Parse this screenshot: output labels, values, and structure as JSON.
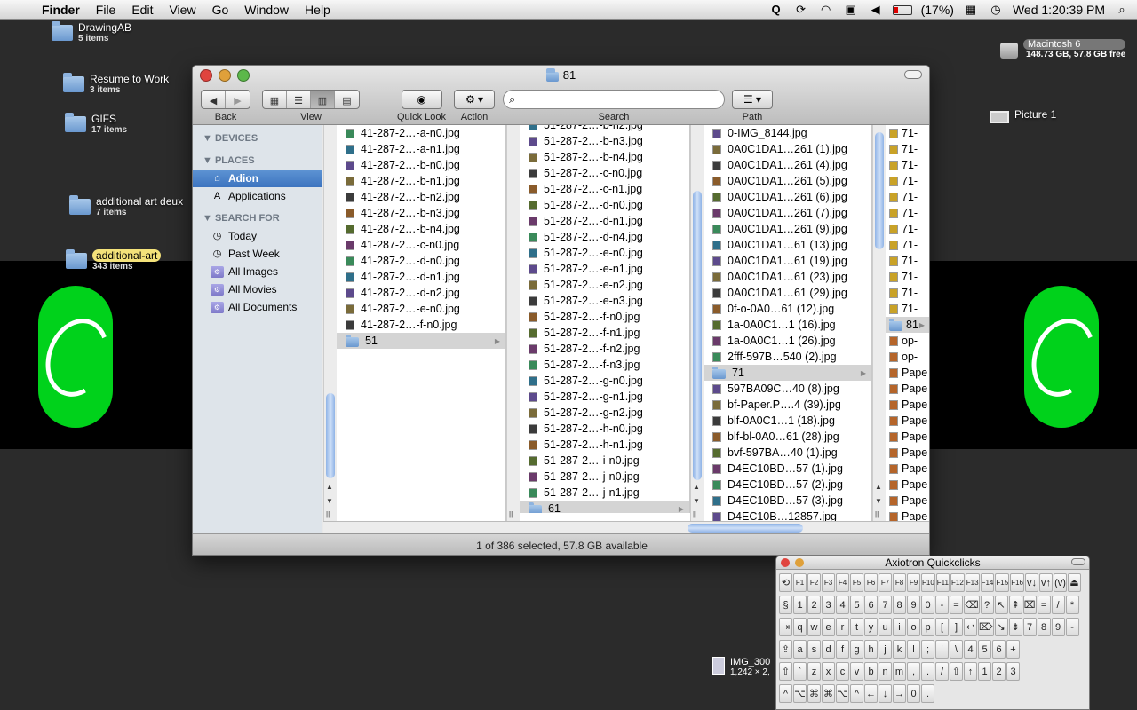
{
  "menubar": {
    "app": "Finder",
    "items": [
      "File",
      "Edit",
      "View",
      "Go",
      "Window",
      "Help"
    ],
    "battery": "(17%)",
    "clock": "Wed 1:20:39 PM"
  },
  "desktop": {
    "icons": [
      {
        "name": "DrawingAB",
        "sub": "5 items"
      },
      {
        "name": "Resume to Work",
        "sub": "3 items"
      },
      {
        "name": "GIFS",
        "sub": "17 items"
      },
      {
        "name": "additional art deux",
        "sub": "7 items"
      },
      {
        "name": "additional-art",
        "sub": "343 items"
      }
    ],
    "drive": {
      "name": "Macintosh 6",
      "sub": "148.73 GB, 57.8 GB free"
    },
    "picture": {
      "name": "Picture 1"
    },
    "img_file": {
      "name": "IMG_300",
      "sub": "1,242 × 2,"
    }
  },
  "finder": {
    "title": "81",
    "toolbar": {
      "back_label": "Back",
      "view_label": "View",
      "quicklook_label": "Quick Look",
      "action_label": "Action",
      "search_label": "Search",
      "search_placeholder": "",
      "path_label": "Path"
    },
    "sidebar": {
      "devices": "DEVICES",
      "places": "PLACES",
      "places_items": [
        "Adion",
        "Applications"
      ],
      "search_for": "SEARCH FOR",
      "search_items": [
        "Today",
        "Past Week",
        "All Images",
        "All Movies",
        "All Documents"
      ]
    },
    "columns": [
      {
        "items": [
          "41-287-2…-a-n0.jpg",
          "41-287-2…-a-n1.jpg",
          "41-287-2…-b-n0.jpg",
          "41-287-2…-b-n1.jpg",
          "41-287-2…-b-n2.jpg",
          "41-287-2…-b-n3.jpg",
          "41-287-2…-b-n4.jpg",
          "41-287-2…-c-n0.jpg",
          "41-287-2…-d-n0.jpg",
          "41-287-2…-d-n1.jpg",
          "41-287-2…-d-n2.jpg",
          "41-287-2…-e-n0.jpg",
          "41-287-2…-f-n0.jpg"
        ],
        "folder": "51"
      },
      {
        "items": [
          "51-287-2…-b-n2.jpg",
          "51-287-2…-b-n3.jpg",
          "51-287-2…-b-n4.jpg",
          "51-287-2…-c-n0.jpg",
          "51-287-2…-c-n1.jpg",
          "51-287-2…-d-n0.jpg",
          "51-287-2…-d-n1.jpg",
          "51-287-2…-d-n4.jpg",
          "51-287-2…-e-n0.jpg",
          "51-287-2…-e-n1.jpg",
          "51-287-2…-e-n2.jpg",
          "51-287-2…-e-n3.jpg",
          "51-287-2…-f-n0.jpg",
          "51-287-2…-f-n1.jpg",
          "51-287-2…-f-n2.jpg",
          "51-287-2…-f-n3.jpg",
          "51-287-2…-g-n0.jpg",
          "51-287-2…-g-n1.jpg",
          "51-287-2…-g-n2.jpg",
          "51-287-2…-h-n0.jpg",
          "51-287-2…-h-n1.jpg",
          "51-287-2…-i-n0.jpg",
          "51-287-2…-j-n0.jpg",
          "51-287-2…-j-n1.jpg"
        ],
        "folder": "61"
      },
      {
        "items_top": [
          "0-IMG_8144.jpg",
          "0A0C1DA1…261 (1).jpg",
          "0A0C1DA1…261 (4).jpg",
          "0A0C1DA1…261 (5).jpg",
          "0A0C1DA1…261 (6).jpg",
          "0A0C1DA1…261 (7).jpg",
          "0A0C1DA1…261 (9).jpg",
          "0A0C1DA1…61 (13).jpg",
          "0A0C1DA1…61 (19).jpg",
          "0A0C1DA1…61 (23).jpg",
          "0A0C1DA1…61 (29).jpg",
          "0f-o-0A0…61 (12).jpg",
          "1a-0A0C1…1 (16).jpg",
          "1a-0A0C1…1 (26).jpg",
          "2fff-597B…540 (2).jpg"
        ],
        "folder": "71",
        "items_bottom": [
          "597BA09C…40 (8).jpg",
          "bf-Paper.P….4 (39).jpg",
          "blf-0A0C1…1 (18).jpg",
          "blf-bl-0A0…61 (28).jpg",
          "bvf-597BA…40 (1).jpg",
          "D4EC10BD…57 (1).jpg",
          "D4EC10BD…57 (2).jpg",
          "D4EC10BD…57 (3).jpg",
          "D4EC10B…12857.jpg"
        ]
      },
      {
        "items_top": [
          "71-",
          "71-",
          "71-",
          "71-",
          "71-",
          "71-",
          "71-",
          "71-",
          "71-",
          "71-",
          "71-",
          "71-"
        ],
        "folder": "81",
        "items_bottom": [
          "op-",
          "op-",
          "Pape",
          "Pape",
          "Pape",
          "Pape",
          "Pape",
          "Pape",
          "Pape",
          "Pape",
          "Pape",
          "Pape"
        ]
      }
    ],
    "status": "1 of 386 selected, 57.8 GB available"
  },
  "quickclicks": {
    "title": "Axiotron Quickclicks",
    "rows": [
      [
        "⟲",
        "F1",
        "F2",
        "F3",
        "F4",
        "F5",
        "F6",
        "F7",
        "F8",
        "F9",
        "F10",
        "F11",
        "F12",
        "F13",
        "F14",
        "F15",
        "F16",
        "v↓",
        "v↑",
        "(v)",
        "⏏"
      ],
      [
        "§",
        "1",
        "2",
        "3",
        "4",
        "5",
        "6",
        "7",
        "8",
        "9",
        "0",
        "-",
        "=",
        "⌫",
        "?",
        "↖",
        "⇞",
        "⌧",
        "=",
        "/",
        "*"
      ],
      [
        "⇥",
        "q",
        "w",
        "e",
        "r",
        "t",
        "y",
        "u",
        "i",
        "o",
        "p",
        "[",
        "]",
        "↩",
        "⌦",
        "↘",
        "⇟",
        "7",
        "8",
        "9",
        "-"
      ],
      [
        "⇪",
        "a",
        "s",
        "d",
        "f",
        "g",
        "h",
        "j",
        "k",
        "l",
        ";",
        "'",
        "\\",
        "4",
        "5",
        "6",
        "+"
      ],
      [
        "⇧",
        "`",
        "z",
        "x",
        "c",
        "v",
        "b",
        "n",
        "m",
        ",",
        ".",
        "/",
        "⇧",
        "↑",
        "1",
        "2",
        "3"
      ],
      [
        "^",
        "⌥",
        "⌘",
        "⌘",
        "⌥",
        "^",
        "←",
        "↓",
        "→",
        "0",
        "."
      ]
    ]
  }
}
